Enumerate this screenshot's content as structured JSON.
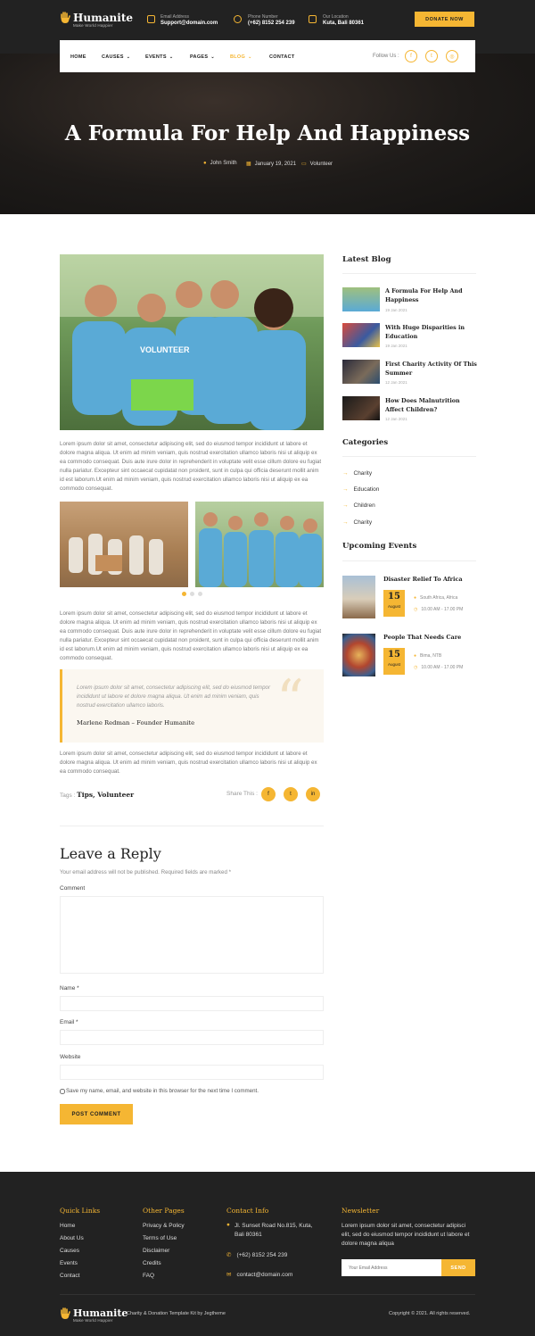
{
  "header": {
    "brand": "Humanite",
    "tagline": "Make World Happier",
    "email_label": "Email Address",
    "email_value": "Support@domain.com",
    "phone_label": "Phone Number",
    "phone_value": "(+62) 8152 254 239",
    "location_label": "Our Location",
    "location_value": "Kuta, Bali 80361",
    "donate_label": "DONATE NOW"
  },
  "nav": {
    "items": [
      "HOME",
      "CAUSES",
      "EVENTS",
      "PAGES",
      "BLOG",
      "CONTACT"
    ],
    "follow_label": "Follow Us :",
    "social_icons": [
      "facebook-icon",
      "twitter-icon",
      "instagram-icon"
    ]
  },
  "hero": {
    "title": "A Formula For Help And Happiness",
    "author": "John Smith",
    "date": "January 19, 2021",
    "category": "Volunteer"
  },
  "article": {
    "para1": "Lorem ipsum dolor sit amet, consectetur adipiscing elit, sed do eiusmod tempor incididunt ut labore et dolore magna aliqua. Ut enim ad minim veniam, quis nostrud exercitation ullamco laboris nisi ut aliquip ex ea commodo consequat. Duis aute irure dolor in reprehenderit in voluptate velit esse cillum dolore eu fugiat nulla pariatur. Excepteur sint occaecat cupidatat non proident, sunt in culpa qui officia deserunt mollit anim id est laborum.Ut enim ad minim veniam, quis nostrud exercitation ullamco laboris nisi ut aliquip ex ea commodo consequat.",
    "para2": "Lorem ipsum dolor sit amet, consectetur adipiscing elit, sed do eiusmod tempor incididunt ut labore et dolore magna aliqua. Ut enim ad minim veniam, quis nostrud exercitation ullamco laboris nisi ut aliquip ex ea commodo consequat. Duis aute irure dolor in reprehenderit in voluptate velit esse cillum dolore eu fugiat nulla pariatur. Excepteur sint occaecat cupidatat non proident, sunt in culpa qui officia deserunt mollit anim id est laborum.Ut enim ad minim veniam, quis nostrud exercitation ullamco laboris nisi ut aliquip ex ea commodo consequat.",
    "quote": "Lorem ipsum dolor sit amet, consectetur adipiscing elit, sed do eiusmod tempor incididunt ut labore et dolore magna aliqua. Ut enim ad minim veniam, quis nostrud exercitation ullamco laboris.",
    "quote_author": "Marlene Redman – Founder Humanite",
    "para3": "Lorem ipsum dolor sit amet, consectetur adipiscing elit, sed do eiusmod tempor incididunt ut labore et dolore magna aliqua. Ut enim ad minim veniam, quis nostrud exercitation ullamco laboris nisi ut aliquip ex ea commodo consequat.",
    "tags_label": "Tags :",
    "tags_value": "Tips, Volunteer",
    "share_label": "Share This :"
  },
  "reply": {
    "title": "Leave a Reply",
    "note": "Your email address will not be published. Required fields are marked *",
    "comment_label": "Comment",
    "name_label": "Name *",
    "email_label": "Email *",
    "website_label": "Website",
    "checkbox_label": "Save my name, email, and website in this browser for the next time I comment.",
    "submit_label": "POST COMMENT"
  },
  "sidebar": {
    "latest_title": "Latest Blog",
    "posts": [
      {
        "title": "A Formula For Help And Happiness",
        "date": "19 Jan 2021"
      },
      {
        "title": "With Huge Disparities in Education",
        "date": "19 Jan 2021"
      },
      {
        "title": "First Charity Activity Of This Summer",
        "date": "12 Jan 2021"
      },
      {
        "title": "How Does Malnutrition Affect Children?",
        "date": "12 Jan 2021"
      }
    ],
    "categories_title": "Categories",
    "categories": [
      "Charity",
      "Education",
      "Children",
      "Charity"
    ],
    "events_title": "Upcoming Events",
    "events": [
      {
        "title": "Disaster Relief To Africa",
        "day": "15",
        "month": "August",
        "location": "South Africa, Africa",
        "time": "10.00 AM - 17.00 PM"
      },
      {
        "title": "People That Needs Care",
        "day": "15",
        "month": "August",
        "location": "Bima, NTB",
        "time": "10.00 AM - 17.00 PM"
      }
    ]
  },
  "footer": {
    "quick_title": "Quick Links",
    "quick_links": [
      "Home",
      "About Us",
      "Causes",
      "Events",
      "Contact"
    ],
    "other_title": "Other Pages",
    "other_links": [
      "Privacy & Policy",
      "Terms of Use",
      "Disclaimer",
      "Credits",
      "FAQ"
    ],
    "contact_title": "Contact Info",
    "address": "Jl. Sunset Road No.815, Kuta, Bali 80361",
    "phone": "(+62) 8152 254 239",
    "email": "contact@domain.com",
    "newsletter_title": "Newsletter",
    "newsletter_text": "Lorem ipsum dolor sit amet, consectetur adipisci elit, sed do eiusmod tempor incididunt ut labore et dolore magna aliqua",
    "newsletter_placeholder": "Your Email Address",
    "send_label": "SEND",
    "brand": "Humanite",
    "tagline": "Make World Happier",
    "credit": "Charity & Donation Template Kit by Jegtheme",
    "copyright": "Copyright © 2021. All rights reserved."
  },
  "colors": {
    "accent": "#f5b633",
    "dark": "#222222"
  }
}
